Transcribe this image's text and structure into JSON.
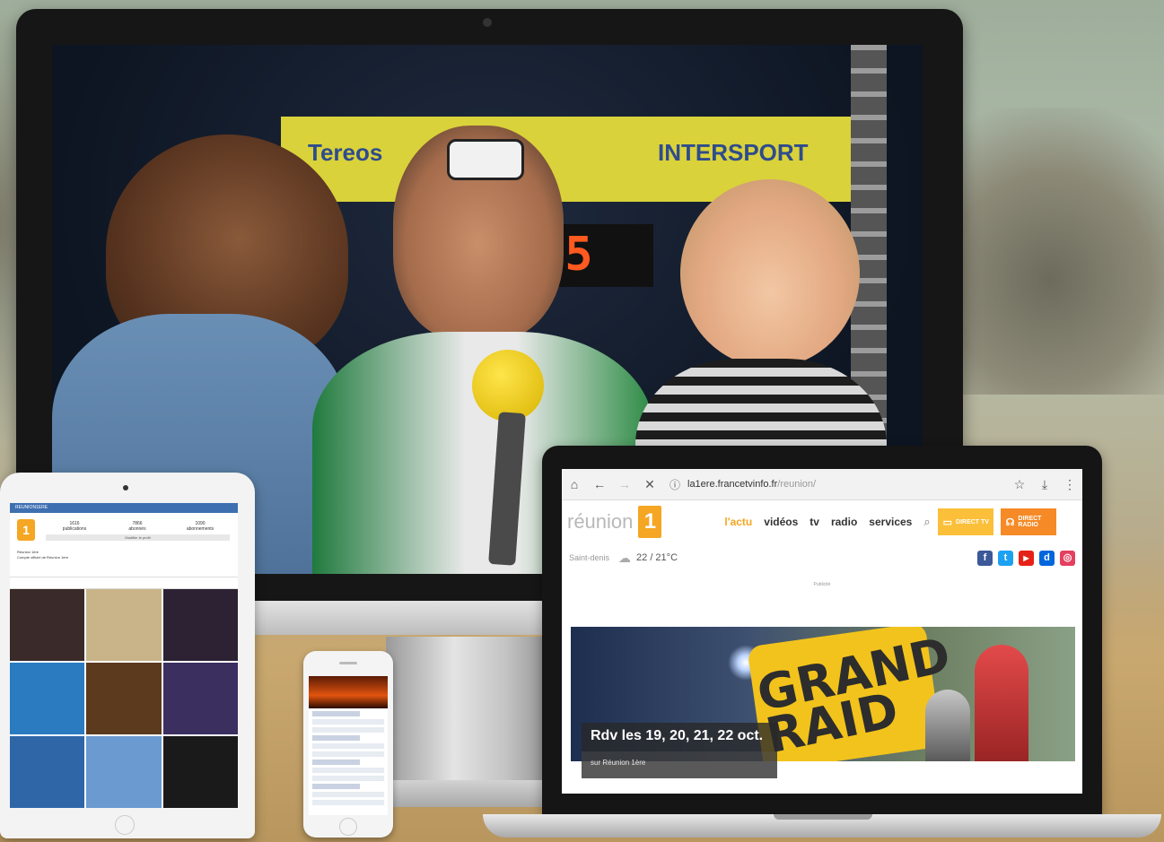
{
  "browser": {
    "url_host": "la1ere.francetvinfo.fr",
    "url_path": "/reunion/"
  },
  "site": {
    "logo_text": "réunion",
    "logo_mark": "1",
    "nav": [
      "l'actu",
      "vidéos",
      "tv",
      "radio",
      "services"
    ],
    "direct_tv": "DIRECT TV",
    "direct_radio": "DIRECT RADIO",
    "weather_place": "Saint-denis",
    "weather_temp": "22 / 21°C",
    "ad_label": "Publicité",
    "hero_title": "Rdv les 19, 20, 21, 22 oct.",
    "hero_subtitle": "sur Réunion 1ère",
    "hero_art_text": "GRAND RAID",
    "social": [
      "f",
      "t",
      "▶",
      "d",
      "◎"
    ],
    "colors": {
      "accent": "#f5a623",
      "facebook": "#3b5998",
      "twitter": "#1da1f2",
      "youtube": "#e62117",
      "dailymotion": "#0066dc",
      "instagram": "#e4405f"
    }
  },
  "photo": {
    "banner_left": "Tereos",
    "banner_right": "INTERSPORT",
    "timer": "25"
  },
  "ipad": {
    "header": "REUNION1ERE",
    "logo_mark": "1",
    "stats": [
      {
        "value": "1616",
        "label": "publications"
      },
      {
        "value": "7866",
        "label": "abonnés"
      },
      {
        "value": "1090",
        "label": "abonnements"
      }
    ],
    "follow_label": "Modifier le profil",
    "bio_name": "Réunion 1ère",
    "bio_text": "Compte officiel de Réunion 1ère",
    "grid": [
      {
        "label": "",
        "color": "#3a2a2a"
      },
      {
        "label": "",
        "color": "#c9b48a"
      },
      {
        "label": "",
        "color": "#2c2233"
      },
      {
        "label": "",
        "color": "#2a7bc0"
      },
      {
        "label": "",
        "color": "#5b3a1e"
      },
      {
        "label": "",
        "color": "#3b2f60"
      },
      {
        "label": "",
        "color": "#2f66a8"
      },
      {
        "label": "",
        "color": "#6a9ad0"
      },
      {
        "label": "",
        "color": "#1a1a1a"
      }
    ]
  }
}
